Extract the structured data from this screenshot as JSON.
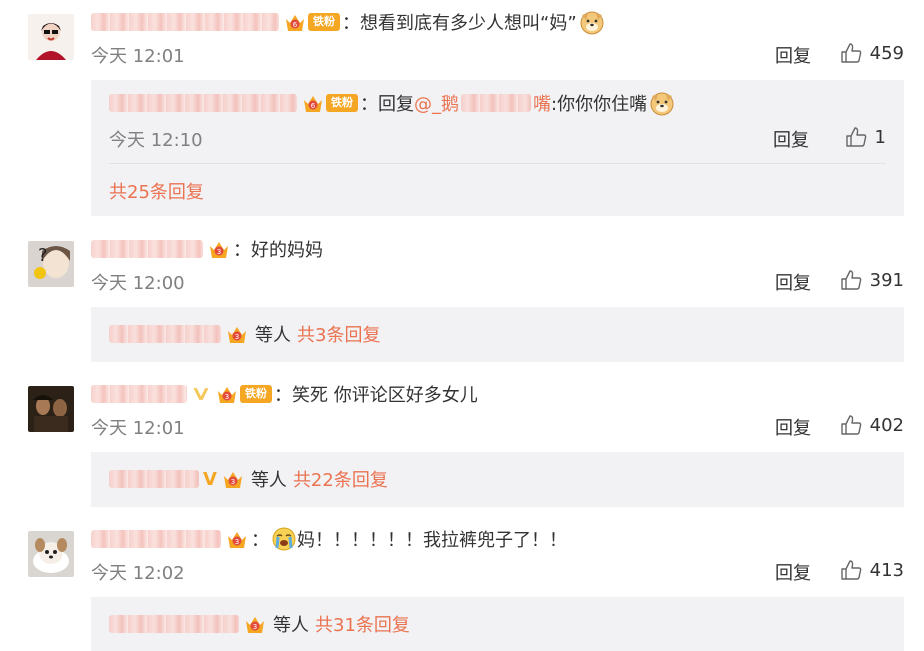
{
  "comments": [
    {
      "time": "今天 12:01",
      "text": "想看到底有多少人想叫“妈”",
      "fan_badge": "铁粉",
      "reply_label": "回复",
      "likes": "459",
      "replies": [
        {
          "prefix": "回复",
          "mention": "@_鹅",
          "mention_tail": "嘴",
          "text": ":你你你住嘴",
          "fan_badge": "铁粉",
          "time": "今天 12:10",
          "reply_label": "回复",
          "likes": "1"
        }
      ],
      "total_replies": "共25条回复"
    },
    {
      "time": "今天 12:00",
      "text": "好的妈妈",
      "reply_label": "回复",
      "likes": "391",
      "etc": "等人",
      "total_replies": "共3条回复"
    },
    {
      "time": "今天 12:01",
      "text": "笑死 你评论区好多女儿",
      "fan_badge": "铁粉",
      "reply_label": "回复",
      "likes": "402",
      "etc": "等人",
      "total_replies": "共22条回复"
    },
    {
      "time": "今天 12:02",
      "text": "妈！！！！！！我拉裤兜子了！！",
      "reply_label": "回复",
      "likes": "413",
      "etc": "等人",
      "total_replies": "共31条回复"
    }
  ],
  "colors": {
    "accent": "#eb7350",
    "badge": "#f5a623",
    "subbox_bg": "#f2f2f5",
    "muted": "#808080"
  }
}
